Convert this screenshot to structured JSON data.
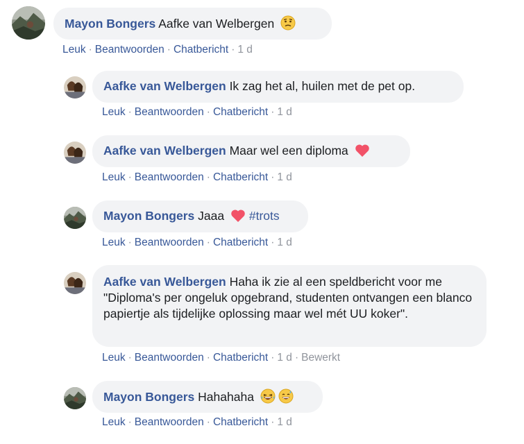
{
  "comments": [
    {
      "author": "Mayon Bongers",
      "text": "Aafke van Welbergen",
      "emoji_after": [
        "worried-face-icon"
      ],
      "actions": {
        "like": "Leuk",
        "reply": "Beantwoorden",
        "chat": "Chatbericht",
        "time": "1 d"
      }
    },
    {
      "author": "Aafke van Welbergen",
      "text": "Ik zag het al, huilen met de pet op.",
      "actions": {
        "like": "Leuk",
        "reply": "Beantwoorden",
        "chat": "Chatbericht",
        "time": "1 d"
      }
    },
    {
      "author": "Aafke van Welbergen",
      "text": "Maar wel een diploma",
      "emoji_after": [
        "heart-icon"
      ],
      "actions": {
        "like": "Leuk",
        "reply": "Beantwoorden",
        "chat": "Chatbericht",
        "time": "1 d"
      }
    },
    {
      "author": "Mayon Bongers",
      "text": "Jaaa",
      "emoji_after": [
        "heart-icon"
      ],
      "hashtag": "#trots",
      "actions": {
        "like": "Leuk",
        "reply": "Beantwoorden",
        "chat": "Chatbericht",
        "time": "1 d"
      }
    },
    {
      "author": "Aafke van Welbergen",
      "text": "Haha ik zie al een speldbericht voor me \"Diploma's per ongeluk opgebrand, studenten ontvangen een blanco papiertje als tijdelijke oplossing maar wel mét UU koker\".",
      "actions": {
        "like": "Leuk",
        "reply": "Beantwoorden",
        "chat": "Chatbericht",
        "time": "1 d",
        "edited": "Bewerkt"
      }
    },
    {
      "author": "Mayon Bongers",
      "text": "Hahahaha",
      "emoji_after": [
        "laughing-face-icon",
        "sweat-smile-face-icon"
      ],
      "actions": {
        "like": "Leuk",
        "reply": "Beantwoorden",
        "chat": "Chatbericht",
        "time": "1 d"
      }
    }
  ],
  "colors": {
    "author_link": "#385898",
    "bubble_bg": "#f2f3f5",
    "meta_gray": "#90949c",
    "heart": "#f25268"
  }
}
